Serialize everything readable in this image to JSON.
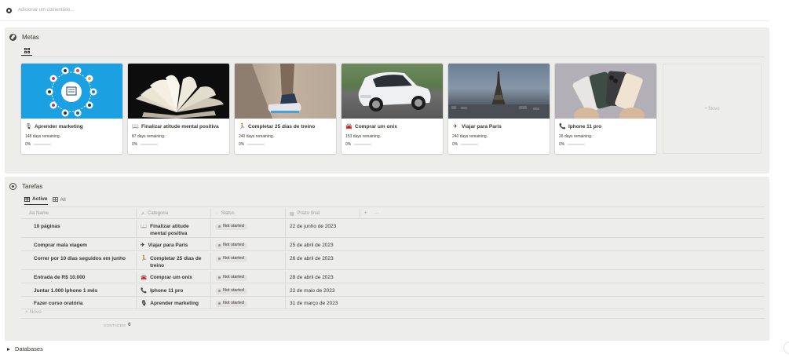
{
  "comment": {
    "placeholder": "Adicionar um comentário..."
  },
  "metas": {
    "title": "Metas",
    "view_icon": "grid-icon",
    "new_label": "+ Novo",
    "cards": [
      {
        "title": "Aprender marketing",
        "icon": "microphone-icon",
        "glyph": "🎙",
        "days": "148 days remaining.",
        "progress_label": "0%",
        "progress": 0
      },
      {
        "title": "Finalizar atitude mental positiva",
        "icon": "book-icon",
        "glyph": "📖",
        "days": "87 days remaining.",
        "progress_label": "0%",
        "progress": 0
      },
      {
        "title": "Completar 25 dias de treino",
        "icon": "running-icon",
        "glyph": "🏃",
        "days": "240 days remaining.",
        "progress_label": "0%",
        "progress": 0
      },
      {
        "title": "Comprar um onix",
        "icon": "car-icon",
        "glyph": "🚘",
        "days": "153 days remaining.",
        "progress_label": "0%",
        "progress": 0
      },
      {
        "title": "Viajar para Paris",
        "icon": "airplane-icon",
        "glyph": "✈",
        "days": "240 days remaining.",
        "progress_label": "0%",
        "progress": 0
      },
      {
        "title": "Iphone 11 pro",
        "icon": "phone-icon",
        "glyph": "📞",
        "days": "26 days remaining.",
        "progress_label": "0%",
        "progress": 0
      }
    ]
  },
  "tarefas": {
    "title": "Tarefas",
    "tabs": [
      {
        "label": "Active"
      },
      {
        "label": "All"
      }
    ],
    "columns": {
      "name": "Aa Name",
      "category": "Categoria",
      "status": "Status",
      "due": "Prazo final"
    },
    "rows": [
      {
        "name": "10 páginas",
        "category": "Finalizar atitude mental positiva",
        "cat_glyph": "📖",
        "status": "Not started",
        "due": "22 de junho de 2023"
      },
      {
        "name": "Comprar mala viagem",
        "category": "Viajar para Paris",
        "cat_glyph": "✈",
        "status": "Not started",
        "due": "25 de abril de 2023"
      },
      {
        "name": "Correr por 10 dias seguidos em junho",
        "category": "Completar 25 dias de treino",
        "cat_glyph": "🏃",
        "status": "Not started",
        "due": "26 de abril de 2023"
      },
      {
        "name": "Entrada de R$ 10.000",
        "category": "Comprar um onix",
        "cat_glyph": "🚘",
        "status": "Not started",
        "due": "28 de abril de 2023"
      },
      {
        "name": "Juntar 1.000 iphone 1 mês",
        "category": "Iphone 11 pro",
        "cat_glyph": "📞",
        "status": "Not started",
        "due": "22 de maio de 2023"
      },
      {
        "name": "Fazer curso oratória",
        "category": "Aprender marketing",
        "cat_glyph": "🎙",
        "status": "Not started",
        "due": "31 de março de 2023"
      }
    ],
    "new_label": "+ Novo",
    "count_label": "CONTAGEM",
    "count_value": "6"
  },
  "databases": {
    "label": "Databases"
  },
  "colors": {
    "panel": "#ededec",
    "text": "#37352f",
    "muted": "#9b9a97",
    "marketing_bg": "#1ba1e2"
  }
}
